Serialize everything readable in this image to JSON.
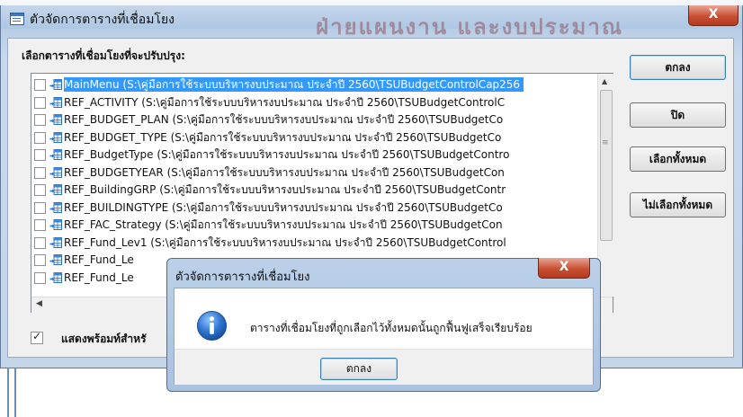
{
  "top_glyph": "ู",
  "window": {
    "title": "ตัวจัดการตารางที่เชื่อมโยง",
    "background_text": "ฝ่ายแผนงาน และงบประมาณ"
  },
  "list": {
    "label": "เลือกตารางที่เชื่อมโยงที่จะปรับปรุง:",
    "items": [
      "MainMenu  (S:\\คู่มือการใช้ระบบบริหารงบประมาณ  ประจำปี  2560\\TSUBudgetControlCap256",
      "REF_ACTIVITY  (S:\\คู่มือการใช้ระบบบริหารงบประมาณ  ประจำปี  2560\\TSUBudgetControlC",
      "REF_BUDGET_PLAN  (S:\\คู่มือการใช้ระบบบริหารงบประมาณ  ประจำปี  2560\\TSUBudgetCo",
      "REF_BUDGET_TYPE  (S:\\คู่มือการใช้ระบบบริหารงบประมาณ  ประจำปี  2560\\TSUBudgetCo",
      "REF_BudgetType  (S:\\คู่มือการใช้ระบบบริหารงบประมาณ  ประจำปี  2560\\TSUBudgetContro",
      "REF_BUDGETYEAR  (S:\\คู่มือการใช้ระบบบริหารงบประมาณ  ประจำปี  2560\\TSUBudgetCon",
      "REF_BuildingGRP  (S:\\คู่มือการใช้ระบบบริหารงบประมาณ  ประจำปี  2560\\TSUBudgetContr",
      "REF_BUILDINGTYPE  (S:\\คู่มือการใช้ระบบบริหารงบประมาณ  ประจำปี  2560\\TSUBudgetCo",
      "REF_FAC_Strategy  (S:\\คู่มือการใช้ระบบบริหารงบประมาณ  ประจำปี  2560\\TSUBudgetCon",
      "REF_Fund_Lev1  (S:\\คู่มือการใช้ระบบบริหารงบประมาณ  ประจำปี  2560\\TSUBudgetControl",
      "REF_Fund_Le",
      "REF_Fund_Le"
    ]
  },
  "buttons": {
    "ok": "ตกลง",
    "close": "ปิด",
    "select_all": "เลือกทั้งหมด",
    "deselect_all": "ไม่เลือกทั้งหมด"
  },
  "show_prompt": {
    "label": "แสดงพร้อมท์สำหรั",
    "checked": true
  },
  "dialog": {
    "title": "ตัวจัดการตารางที่เชื่อมโยง",
    "message": "ตารางที่เชื่อมโยงที่ถูกเลือกไว้ทั้งหมดนั้นถูกฟื้นฟูเสร็จเรียบร้อย",
    "ok": "ตกลง"
  },
  "close_glyph": "X",
  "icons": [
    "window-icon",
    "linked-table-icon",
    "info-icon",
    "close-icon"
  ],
  "colors": {
    "selection": "#3399ff",
    "title_bar": "#c5d6ea",
    "close_button": "#c94f33"
  }
}
